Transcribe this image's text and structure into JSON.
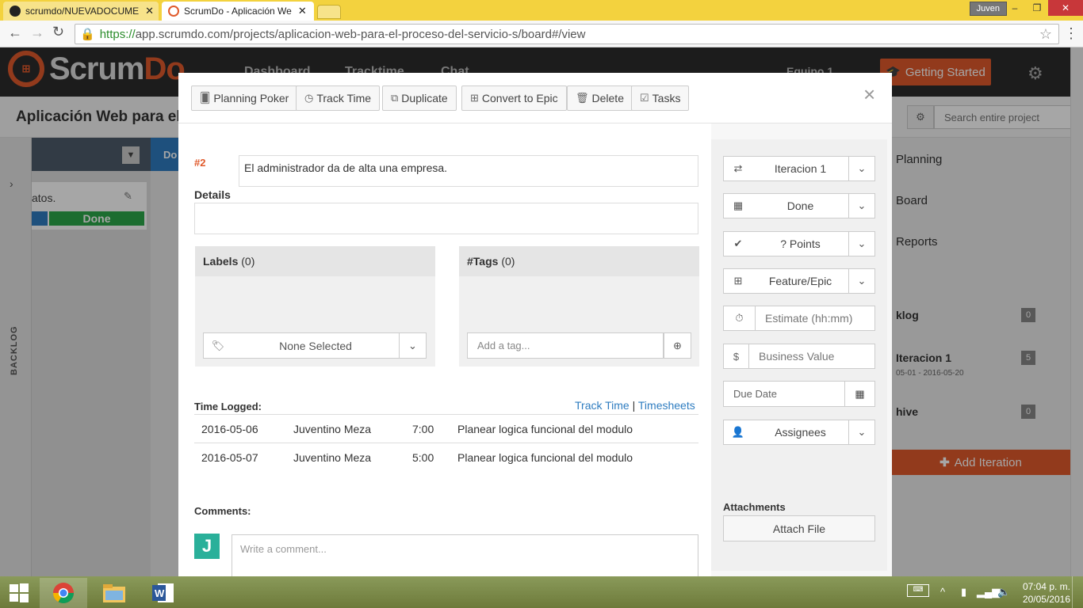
{
  "browser": {
    "tabs": [
      {
        "title": "scrumdo/NUEVADOCUME",
        "active": false
      },
      {
        "title": "ScrumDo - Aplicación We",
        "active": true
      }
    ],
    "user_badge": "Juven",
    "url_https": "https://",
    "url_rest": "app.scrumdo.com/projects/aplicacion-web-para-el-proceso-del-servicio-s/board#/view",
    "window_controls": {
      "minimize": "–",
      "maximize": "❐",
      "close": "✕"
    }
  },
  "app": {
    "logo_text_a": "Scrum",
    "logo_text_b": "Do",
    "nav": [
      "Dashboard",
      "Tracktime",
      "Chat"
    ],
    "workspace": "Equipo 1",
    "getting_started": "Getting Started",
    "project_title": "Aplicación Web para el",
    "search_placeholder": "Search entire project",
    "backlog_tab": "BACKLOG",
    "column_header": "Do",
    "card_text": "atos.",
    "done_label": "Done",
    "right_panel": {
      "items": [
        "Planning",
        "Board",
        "Reports"
      ],
      "sections": [
        {
          "label": "klog",
          "count": "0"
        },
        {
          "label": "Iteracion 1",
          "count": "5",
          "dates": "05-01 - 2016-05-20"
        },
        {
          "label": "hive",
          "count": "0"
        }
      ],
      "add_iteration": "Add Iteration"
    }
  },
  "modal": {
    "toolbar": [
      {
        "label": "Planning Poker",
        "icon": "poker-icon"
      },
      {
        "label": "Track Time",
        "icon": "clock-icon"
      },
      {
        "label": "Duplicate",
        "icon": "duplicate-icon"
      },
      {
        "label": "Convert to Epic",
        "icon": "hierarchy-icon"
      },
      {
        "label": "Delete",
        "icon": "trash-icon"
      },
      {
        "label": "Tasks",
        "icon": "checklist-icon"
      }
    ],
    "close": "×",
    "story_number": "#2",
    "summary": "El administrador da de alta una empresa.",
    "details_label": "Details",
    "labels": {
      "title": "Labels",
      "count": "(0)",
      "select_text": "None Selected"
    },
    "tags": {
      "title": "#Tags",
      "count": "(0)",
      "placeholder": "Add a tag..."
    },
    "time_logged": {
      "label": "Time Logged:",
      "link_track": "Track Time",
      "separator": "|",
      "link_timesheets": "Timesheets",
      "rows": [
        {
          "date": "2016-05-06",
          "user": "Juventino Meza",
          "time": "7:00",
          "note": "Planear logica funcional del modulo"
        },
        {
          "date": "2016-05-07",
          "user": "Juventino Meza",
          "time": "5:00",
          "note": "Planear logica funcional del modulo"
        }
      ]
    },
    "comments_label": "Comments:",
    "avatar_letter": "J",
    "comment_placeholder": "Write a comment...",
    "side": {
      "iteration": "Iteracion 1",
      "status": "Done",
      "points": "? Points",
      "epic": "Feature/Epic",
      "estimate_placeholder": "Estimate (hh:mm)",
      "business_value_placeholder": "Business Value",
      "currency_symbol": "$",
      "due_date_placeholder": "Due Date",
      "assignees": "Assignees",
      "attachments_label": "Attachments",
      "attach_button": "Attach File"
    }
  },
  "taskbar": {
    "time": "07:04 p. m.",
    "date": "20/05/2016"
  },
  "colors": {
    "brand": "#e05a2b",
    "done": "#2ba84a",
    "link": "#2e7cc0",
    "chrome_tab": "#f3d23e"
  }
}
